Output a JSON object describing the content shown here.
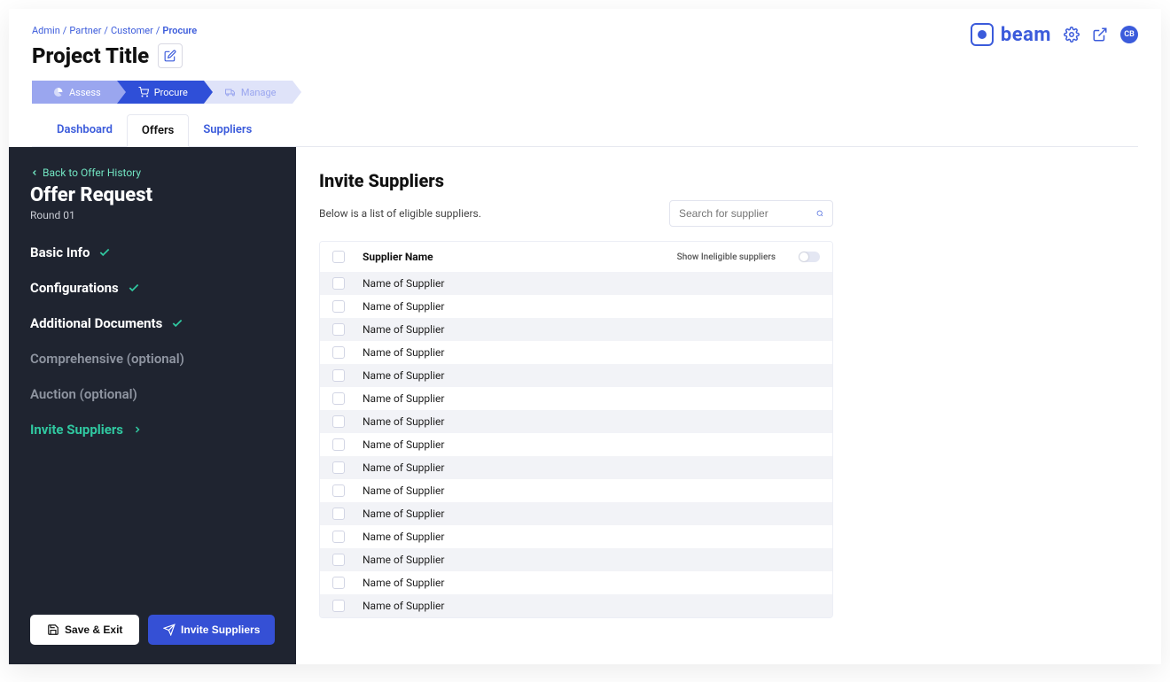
{
  "breadcrumb": [
    "Admin",
    "Partner",
    "Customer",
    "Procure"
  ],
  "project_title": "Project Title",
  "brand": {
    "name": "beam",
    "avatar_initials": "CB"
  },
  "stages": [
    {
      "key": "assess",
      "label": "Assess"
    },
    {
      "key": "procure",
      "label": "Procure"
    },
    {
      "key": "manage",
      "label": "Manage"
    }
  ],
  "subtabs": [
    {
      "label": "Dashboard",
      "active": false
    },
    {
      "label": "Offers",
      "active": true
    },
    {
      "label": "Suppliers",
      "active": false
    }
  ],
  "sidebar": {
    "back_label": "Back to Offer History",
    "title": "Offer Request",
    "subtitle": "Round 01",
    "steps": [
      {
        "label": "Basic Info",
        "status": "done"
      },
      {
        "label": "Configurations",
        "status": "done"
      },
      {
        "label": "Additional Documents",
        "status": "done"
      },
      {
        "label": "Comprehensive (optional)",
        "status": "muted"
      },
      {
        "label": "Auction (optional)",
        "status": "muted"
      },
      {
        "label": "Invite Suppliers",
        "status": "current"
      }
    ],
    "save_exit_label": "Save & Exit",
    "invite_label": "Invite Suppliers"
  },
  "main": {
    "title": "Invite Suppliers",
    "desc": "Below is a list of eligible suppliers.",
    "search_placeholder": "Search for supplier",
    "col_header": "Supplier Name",
    "toggle_label": "Show Ineligible suppliers",
    "rows": [
      "Name of Supplier",
      "Name of Supplier",
      "Name of Supplier",
      "Name of Supplier",
      "Name of Supplier",
      "Name of Supplier",
      "Name of Supplier",
      "Name of Supplier",
      "Name of Supplier",
      "Name of Supplier",
      "Name of Supplier",
      "Name of Supplier",
      "Name of Supplier",
      "Name of Supplier",
      "Name of Supplier"
    ]
  }
}
